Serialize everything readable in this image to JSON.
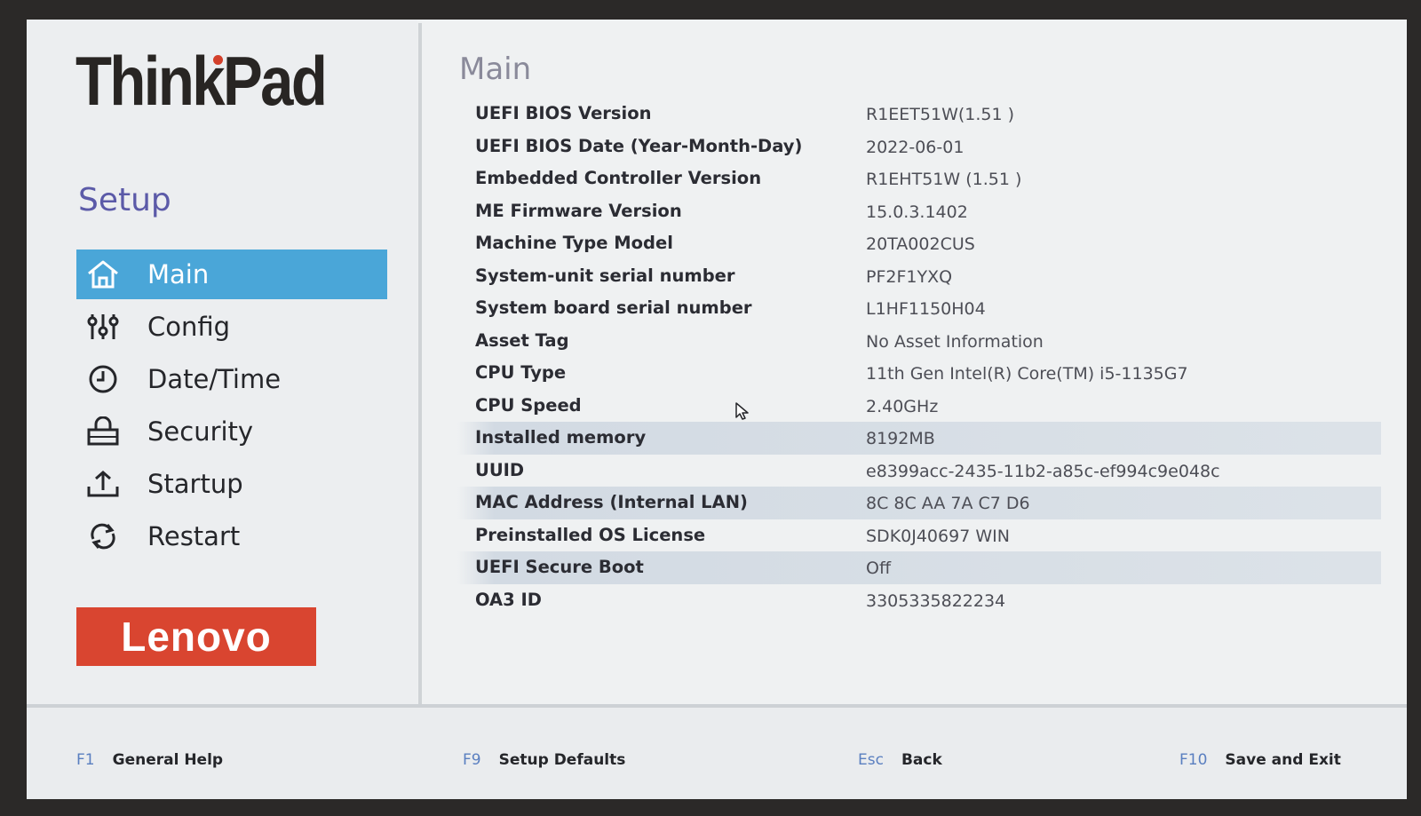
{
  "sidebar": {
    "brand": "ThinkPad",
    "setup_title": "Setup",
    "items": [
      {
        "label": "Main",
        "icon": "home-icon",
        "active": true
      },
      {
        "label": "Config",
        "icon": "sliders-icon",
        "active": false
      },
      {
        "label": "Date/Time",
        "icon": "clock-icon",
        "active": false
      },
      {
        "label": "Security",
        "icon": "lock-icon",
        "active": false
      },
      {
        "label": "Startup",
        "icon": "upload-icon",
        "active": false
      },
      {
        "label": "Restart",
        "icon": "refresh-icon",
        "active": false
      }
    ],
    "logo": "Lenovo"
  },
  "main": {
    "title": "Main",
    "rows": [
      {
        "label": "UEFI BIOS Version",
        "value": "R1EET51W(1.51 )",
        "highlight": false
      },
      {
        "label": "UEFI BIOS Date (Year-Month-Day)",
        "value": "2022-06-01",
        "highlight": false
      },
      {
        "label": "Embedded Controller Version",
        "value": "R1EHT51W (1.51 )",
        "highlight": false
      },
      {
        "label": "ME Firmware Version",
        "value": "15.0.3.1402",
        "highlight": false
      },
      {
        "label": "Machine Type Model",
        "value": "20TA002CUS",
        "highlight": false
      },
      {
        "label": "System-unit serial number",
        "value": "PF2F1YXQ",
        "highlight": false
      },
      {
        "label": "System board serial number",
        "value": "L1HF1150H04",
        "highlight": false
      },
      {
        "label": "Asset Tag",
        "value": "No Asset Information",
        "highlight": false
      },
      {
        "label": "CPU Type",
        "value": "11th Gen Intel(R) Core(TM) i5-1135G7",
        "highlight": false
      },
      {
        "label": "CPU Speed",
        "value": "2.40GHz",
        "highlight": false
      },
      {
        "label": "Installed memory",
        "value": "8192MB",
        "highlight": true
      },
      {
        "label": "UUID",
        "value": "e8399acc-2435-11b2-a85c-ef994c9e048c",
        "highlight": false
      },
      {
        "label": "MAC Address (Internal LAN)",
        "value": "8C 8C AA 7A C7 D6",
        "highlight": true
      },
      {
        "label": "Preinstalled OS License",
        "value": "SDK0J40697 WIN",
        "highlight": false
      },
      {
        "label": "UEFI Secure Boot",
        "value": "Off",
        "highlight": true
      },
      {
        "label": "OA3 ID",
        "value": "3305335822234",
        "highlight": false
      }
    ]
  },
  "footer": {
    "keys": [
      {
        "key": "F1",
        "label": "General Help"
      },
      {
        "key": "F9",
        "label": "Setup Defaults"
      },
      {
        "key": "Esc",
        "label": "Back"
      },
      {
        "key": "F10",
        "label": "Save and Exit"
      }
    ]
  },
  "colors": {
    "accent": "#4aa6d8",
    "setup_title": "#5b5aa8",
    "lenovo_red": "#d94530",
    "fkey": "#5a7fc0"
  }
}
